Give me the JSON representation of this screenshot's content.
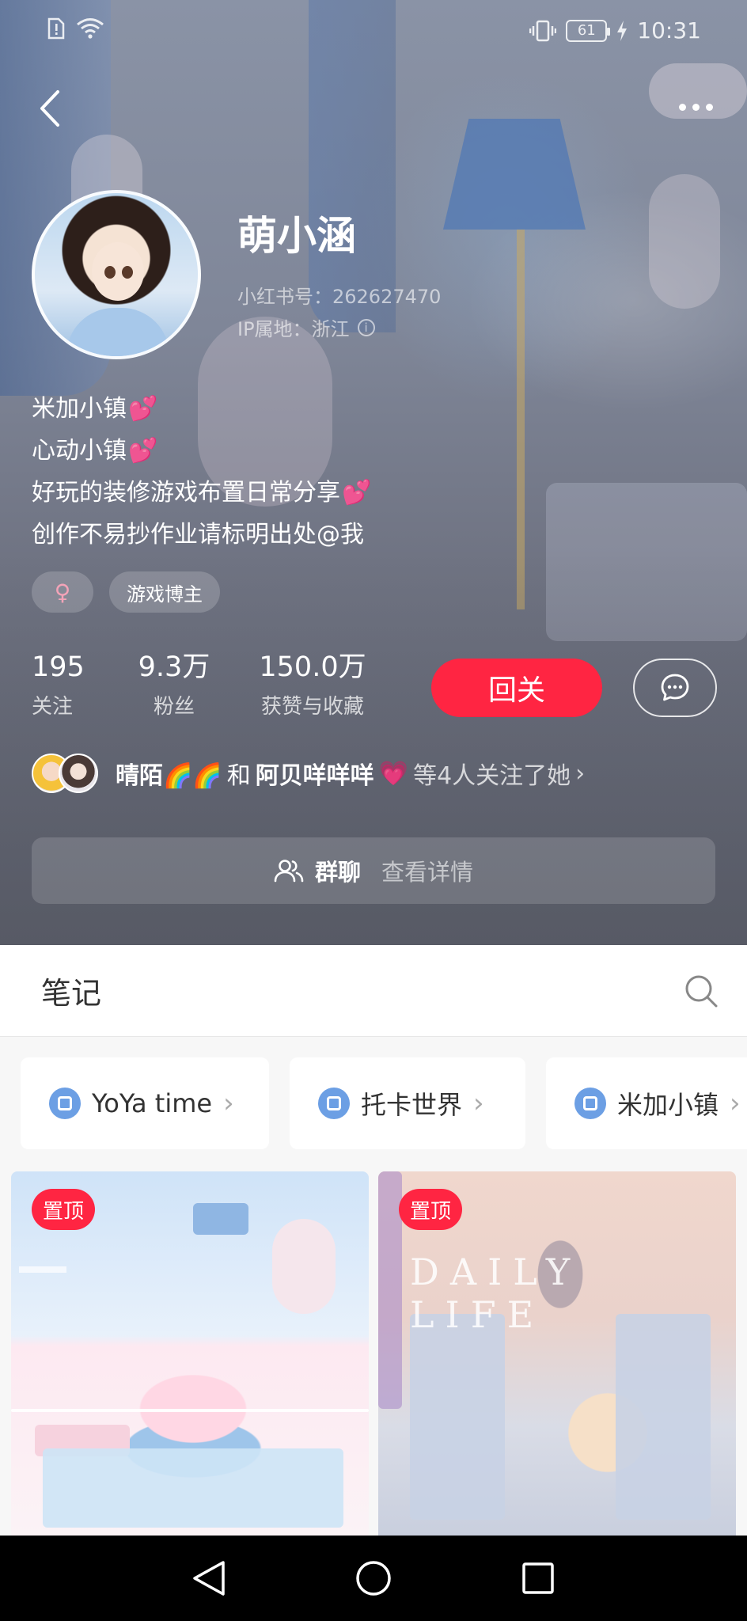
{
  "status_bar": {
    "time": "10:31",
    "battery": "61",
    "icons": [
      "sim-alert-icon",
      "wifi-icon",
      "vibrate-icon",
      "battery-icon",
      "charging-icon"
    ]
  },
  "profile": {
    "nickname": "萌小涵",
    "red_id": "小红书号：262627470",
    "ip_location": "IP属地：浙江",
    "bio_lines": [
      "米加小镇",
      "心动小镇",
      "好玩的装修游戏布置日常分享",
      "创作不易抄作业请标明出处@我"
    ],
    "tags": {
      "gender": "♀",
      "category": "游戏博主"
    },
    "stats": [
      {
        "value": "195",
        "label": "关注"
      },
      {
        "value": "9.3万",
        "label": "粉丝"
      },
      {
        "value": "150.0万",
        "label": "获赞与收藏"
      }
    ],
    "follow_back_label": "回关",
    "mutual": {
      "user1": "晴陌🌈🌈",
      "connector": "和",
      "user2": "阿贝咩咩咩",
      "suffix": "等4人关注了她"
    },
    "group_chat": {
      "label": "群聊",
      "detail": "查看详情"
    }
  },
  "notes": {
    "title": "笔记",
    "collections": [
      {
        "label": "YoYa time"
      },
      {
        "label": "托卡世界"
      },
      {
        "label": "米加小镇"
      }
    ],
    "cards": [
      {
        "badge": "置顶"
      },
      {
        "badge": "置顶",
        "overlay_text": "DAILY LIFE"
      }
    ]
  },
  "colors": {
    "accent": "#ff2542",
    "collection_icon": "#6c9fe4"
  }
}
